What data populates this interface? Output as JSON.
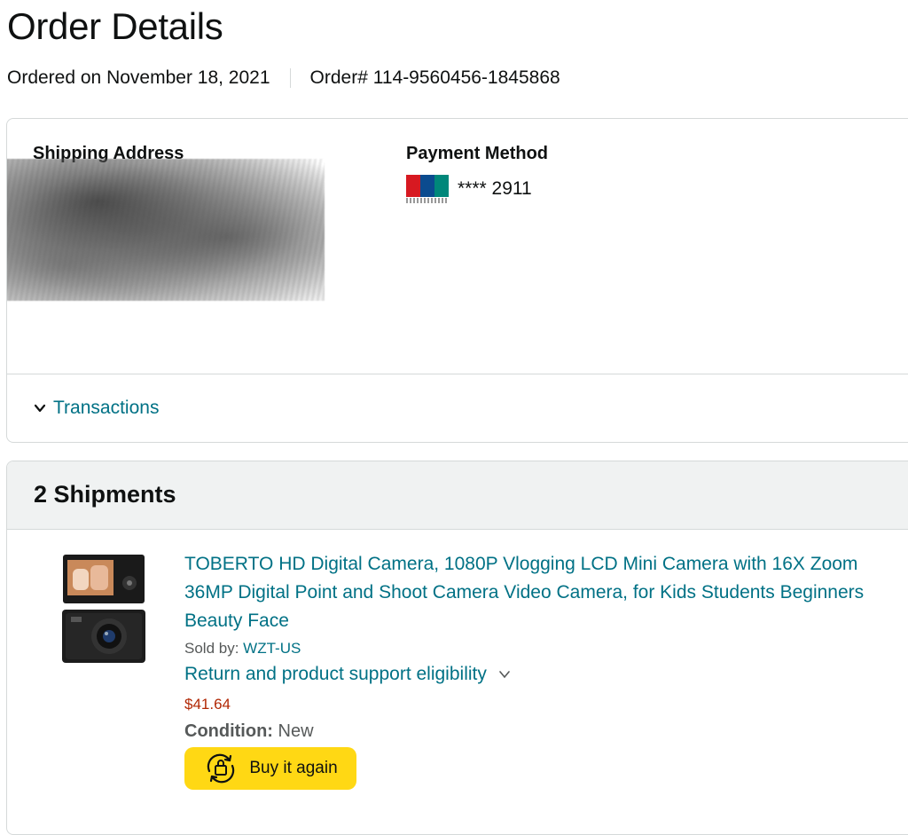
{
  "header": {
    "title": "Order Details",
    "ordered_on": "Ordered on November 18, 2021",
    "order_number": "Order# 114-9560456-1845868"
  },
  "summary": {
    "shipping_label": "Shipping Address",
    "payment_label": "Payment Method",
    "card_masked": "**** 2911",
    "card_icon": "unionpay-card-icon",
    "transactions_label": "Transactions"
  },
  "shipments": {
    "heading": "2 Shipments",
    "item": {
      "title_line1": "TOBERTO HD Digital Camera, 1080P Vlogging LCD Mini Camera with 16X Zoom",
      "title_line2": "36MP Digital Point and Shoot Camera Video Camera, for Kids Students Beginners",
      "title_line3": "Beauty Face",
      "sold_by_label": "Sold by:",
      "seller": "WZT-US",
      "return_label": "Return and product support eligibility",
      "price": "$41.64",
      "condition_label": "Condition:",
      "condition_value": "New",
      "buy_again_label": "Buy it again"
    }
  },
  "colors": {
    "link": "#007185",
    "price": "#b12704",
    "button": "#ffd814",
    "header_bg": "#f0f2f2",
    "border": "#d5d9d9"
  }
}
